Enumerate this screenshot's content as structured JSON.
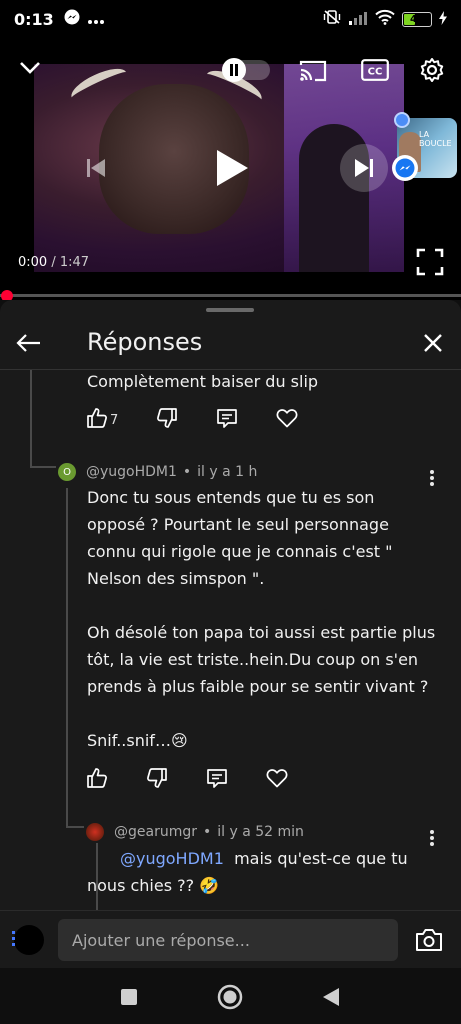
{
  "status_bar": {
    "time": "0:13",
    "battery": "40",
    "battery_level": 0.4,
    "icons": [
      "messenger-icon",
      "more-dots-icon",
      "mute-vibrate-icon",
      "signal-icon",
      "wifi-icon",
      "battery-icon",
      "charging-icon"
    ]
  },
  "player": {
    "current_time": "0:00",
    "duration": "1:47",
    "progress": 0.0,
    "controls": [
      "collapse-chevron-icon",
      "autoplay-pause-toggle",
      "cast-icon",
      "captions-icon",
      "settings-gear-icon",
      "previous-icon",
      "play-icon",
      "next-icon",
      "fullscreen-icon"
    ],
    "captions_label": "CC",
    "chathead_text": "LA BOUCLE"
  },
  "panel": {
    "title": "Réponses"
  },
  "comments": [
    {
      "text": "Complètement baiser du slip",
      "likes": "7"
    },
    {
      "author": "@yugoHDM1",
      "avatar_letter": "O",
      "time": "il y a 1 h",
      "paragraph1_lines": [
        "Donc tu sous entends que tu es son",
        "opposé ? Pourtant le seul personnage",
        "connu qui rigole que je connais c'est \"",
        "Nelson des simspon \"."
      ],
      "paragraph2_lines": [
        "Oh désolé ton papa toi aussi est partie plus",
        "tôt, la vie est triste..hein.Du coup on s'en",
        "prends à plus faible pour se sentir vivant ?"
      ],
      "paragraph3": "Snif..snif…😢"
    },
    {
      "author": "@gearumgr",
      "time": "il y a 52 min",
      "mention": "@yugoHDM1",
      "line1": "mais qu'est-ce que tu",
      "line2": "nous chies ?? 🤣"
    }
  ],
  "reply_bar": {
    "placeholder": "Ajouter une réponse..."
  },
  "colors": {
    "background": "#0f0f0f",
    "panel": "#1a1a1a",
    "progress_dot": "#ff0033",
    "mention": "#7fa8ff"
  }
}
